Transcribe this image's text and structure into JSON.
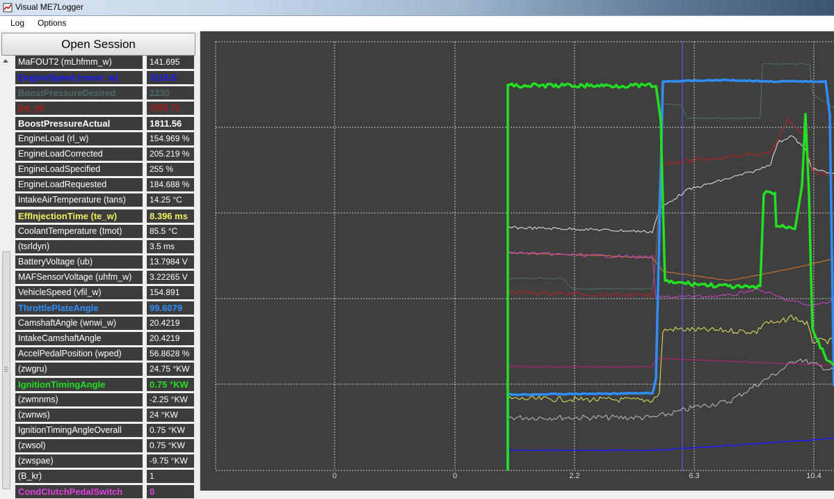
{
  "window": {
    "title": "Visual ME7Logger"
  },
  "menu": {
    "log": "Log",
    "options": "Options"
  },
  "session": {
    "open_label": "Open Session"
  },
  "channels": [
    {
      "name": "MaFOUT2 (mLhfmm_w)",
      "value": "141.695",
      "color": "#ffffff",
      "bold": false
    },
    {
      "name": "EngineSpeed (nmot_w)",
      "value": "3115.5",
      "color": "#1a1aff",
      "bold": true
    },
    {
      "name": "BoostPressureDesired",
      "value": "2230",
      "color": "#4a6a6a",
      "bold": true
    },
    {
      "name": "(ps_w)",
      "value": "1892.73",
      "color": "#e01010",
      "bold": false
    },
    {
      "name": "BoostPressureActual",
      "value": "1811.56",
      "color": "#ffffff",
      "bold": true
    },
    {
      "name": "EngineLoad (rl_w)",
      "value": "154.969 %",
      "color": "#ffffff",
      "bold": false
    },
    {
      "name": "EngineLoadCorrected",
      "value": "205.219 %",
      "color": "#ffffff",
      "bold": false
    },
    {
      "name": "EngineLoadSpecified",
      "value": "255 %",
      "color": "#ffffff",
      "bold": false
    },
    {
      "name": "EngineLoadRequested",
      "value": "184.688 %",
      "color": "#ffffff",
      "bold": false
    },
    {
      "name": "IntakeAirTemperature (tans)",
      "value": "14.25 °C",
      "color": "#ffffff",
      "bold": false
    },
    {
      "name": "EffInjectionTime (te_w)",
      "value": "8.396 ms",
      "color": "#f0f060",
      "bold": true
    },
    {
      "name": "CoolantTemperature (tmot)",
      "value": "85.5 °C",
      "color": "#ffffff",
      "bold": false
    },
    {
      "name": "(tsrldyn)",
      "value": "3.5 ms",
      "color": "#ffffff",
      "bold": false
    },
    {
      "name": "BatteryVoltage (ub)",
      "value": "13.7984 V",
      "color": "#ffffff",
      "bold": false
    },
    {
      "name": "MAFSensorVoltage (uhfm_w)",
      "value": "3.22265 V",
      "color": "#ffffff",
      "bold": false
    },
    {
      "name": "VehicleSpeed (vfil_w)",
      "value": "154.891",
      "color": "#ffffff",
      "bold": false
    },
    {
      "name": "ThrottlePlateAngle",
      "value": "99.6079",
      "color": "#2f8fff",
      "bold": true
    },
    {
      "name": "CamshaftAngle (wnwi_w)",
      "value": "20.4219",
      "color": "#ffffff",
      "bold": false
    },
    {
      "name": "IntakeCamshaftAngle",
      "value": "20.4219",
      "color": "#ffffff",
      "bold": false
    },
    {
      "name": "AccelPedalPosition (wped)",
      "value": "56.8628 %",
      "color": "#ffffff",
      "bold": false
    },
    {
      "name": "(zwgru)",
      "value": "24.75 °KW",
      "color": "#ffffff",
      "bold": false
    },
    {
      "name": "IgnitionTimingAngle",
      "value": "0.75 °KW",
      "color": "#22e022",
      "bold": true
    },
    {
      "name": "(zwmnms)",
      "value": "-2.25 °KW",
      "color": "#ffffff",
      "bold": false
    },
    {
      "name": "(zwnws)",
      "value": "24 °KW",
      "color": "#ffffff",
      "bold": false
    },
    {
      "name": "IgnitionTimingAngleOverall",
      "value": "0.75 °KW",
      "color": "#ffffff",
      "bold": false
    },
    {
      "name": "(zwsol)",
      "value": "0.75 °KW",
      "color": "#ffffff",
      "bold": false
    },
    {
      "name": "(zwspae)",
      "value": "-9.75 °KW",
      "color": "#ffffff",
      "bold": false
    },
    {
      "name": "(B_kr)",
      "value": "1",
      "color": "#ffffff",
      "bold": false
    },
    {
      "name": "CondClutchPedalSwitch",
      "value": "0",
      "color": "#e040e0",
      "bold": true
    }
  ],
  "chart": {
    "x_tick_labels": [
      "0",
      "0",
      "2.2",
      "6.3",
      "10.4"
    ],
    "background": "#3f3f3f"
  }
}
